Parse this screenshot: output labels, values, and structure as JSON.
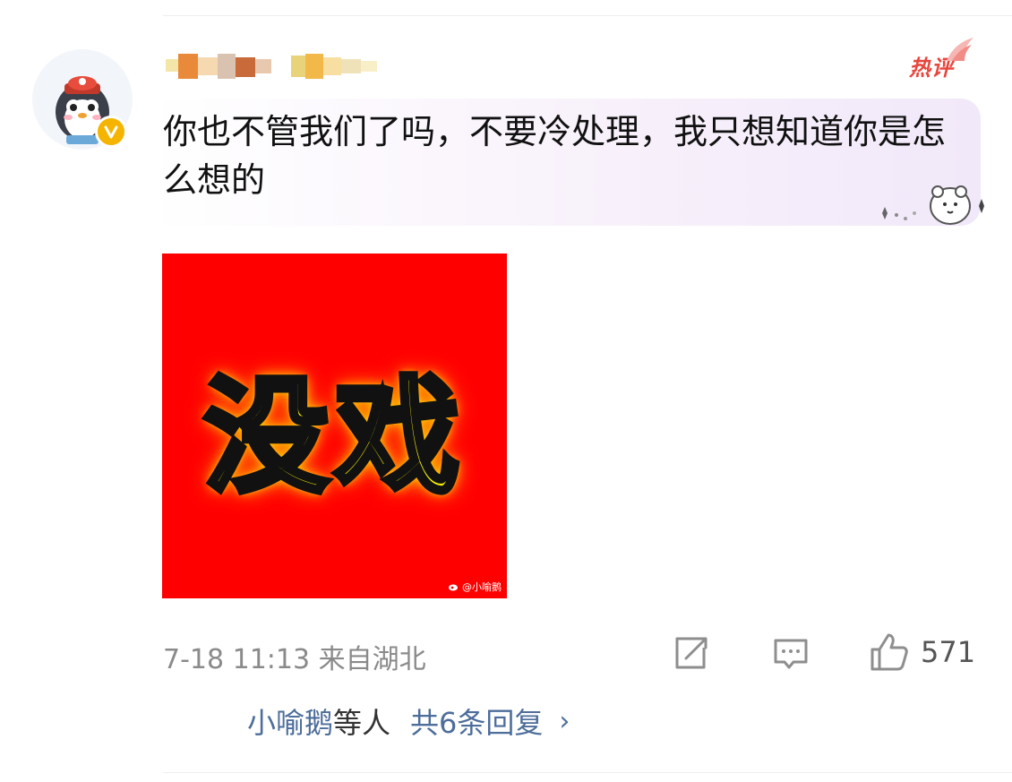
{
  "comment": {
    "text": "你也不管我们了吗，不要冷处理，我只想知道你是怎么想的",
    "hot_label": "热评",
    "timestamp": "7-18 11:13",
    "location": "来自湖北",
    "like_count": "571"
  },
  "sticker": {
    "word": "没戏",
    "watermark": "@小喻鹅",
    "bg_color": "#ff0000",
    "text_color": "#f6f000"
  },
  "replies": {
    "names": "小喻鹅",
    "suffix": "等人",
    "link_text": "共6条回复",
    "chevron": "›"
  },
  "icons": {
    "share": "share-icon",
    "comment": "comment-icon",
    "like": "thumbs-up-icon",
    "verified": "verified-badge-icon"
  },
  "colors": {
    "accent_link": "#4d6d9a",
    "hot": "#e8453c",
    "badge": "#f5b400"
  }
}
